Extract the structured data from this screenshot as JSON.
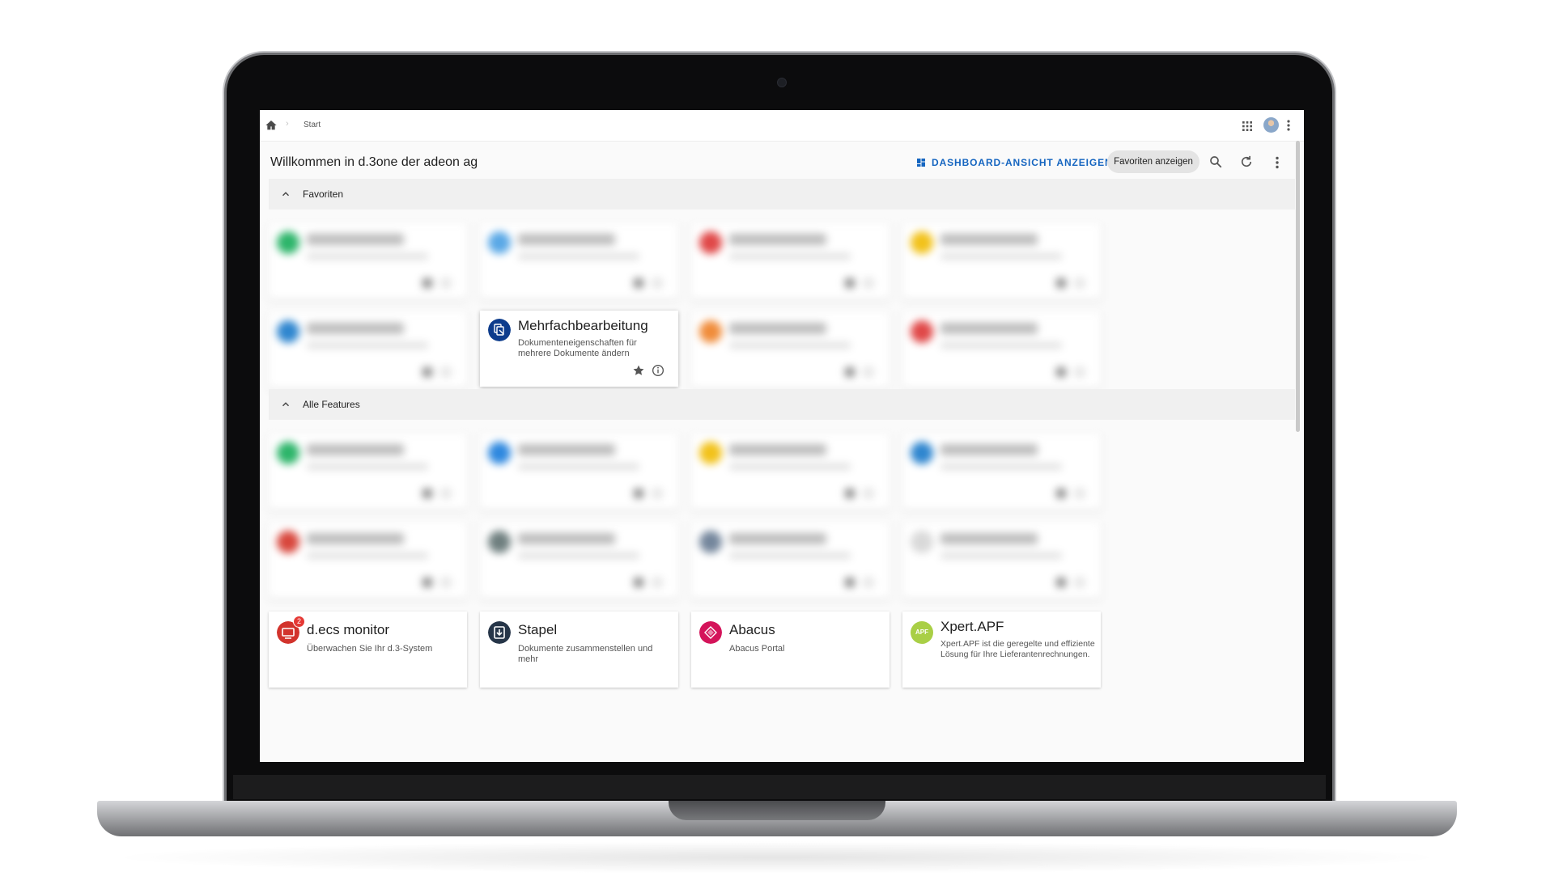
{
  "breadcrumb": {
    "current": "Start"
  },
  "header": {
    "title": "Willkommen in d.3one der adeon ag",
    "dashboard_button": "DASHBOARD-ANSICHT ANZEIGEN",
    "favorites_toggle": "Favoriten anzeigen"
  },
  "sections": {
    "favorites": "Favoriten",
    "all_features": "Alle Features"
  },
  "cards": {
    "mehrfach": {
      "title": "Mehrfachbearbeitung",
      "subtitle": "Dokumenteneigenschaften für mehrere Dokumente ändern",
      "icon": "multi-edit-icon",
      "color": "#0d3c8c"
    },
    "decs": {
      "title": "d.ecs monitor",
      "subtitle": "Überwachen Sie Ihr d.3-System",
      "badge": "2",
      "icon": "monitor-icon",
      "color": "#d2332c"
    },
    "stapel": {
      "title": "Stapel",
      "subtitle": "Dokumente zusammenstellen und mehr",
      "icon": "stack-icon",
      "color": "#263548"
    },
    "abacus": {
      "title": "Abacus",
      "subtitle": "Abacus Portal",
      "icon": "abacus-icon",
      "color": "#d4145a"
    },
    "xpert": {
      "title": "Xpert.APF",
      "subtitle": "Xpert.APF ist die geregelte und effiziente Lösung für Ihre Lieferantenrechnungen.",
      "icon_text": "APF",
      "color": "#a9cf46"
    }
  },
  "blurred_colors": [
    "#2db56a",
    "#5aa8e6",
    "#e04848",
    "#f2c21b",
    "#2f86cf",
    "#f08c3a",
    "#e04848",
    "#2db56a",
    "#2e88df",
    "#f2c21b",
    "#2f86cf",
    "#d8473d",
    "#6f7f7f",
    "#74869c",
    "#d9d9d9"
  ]
}
